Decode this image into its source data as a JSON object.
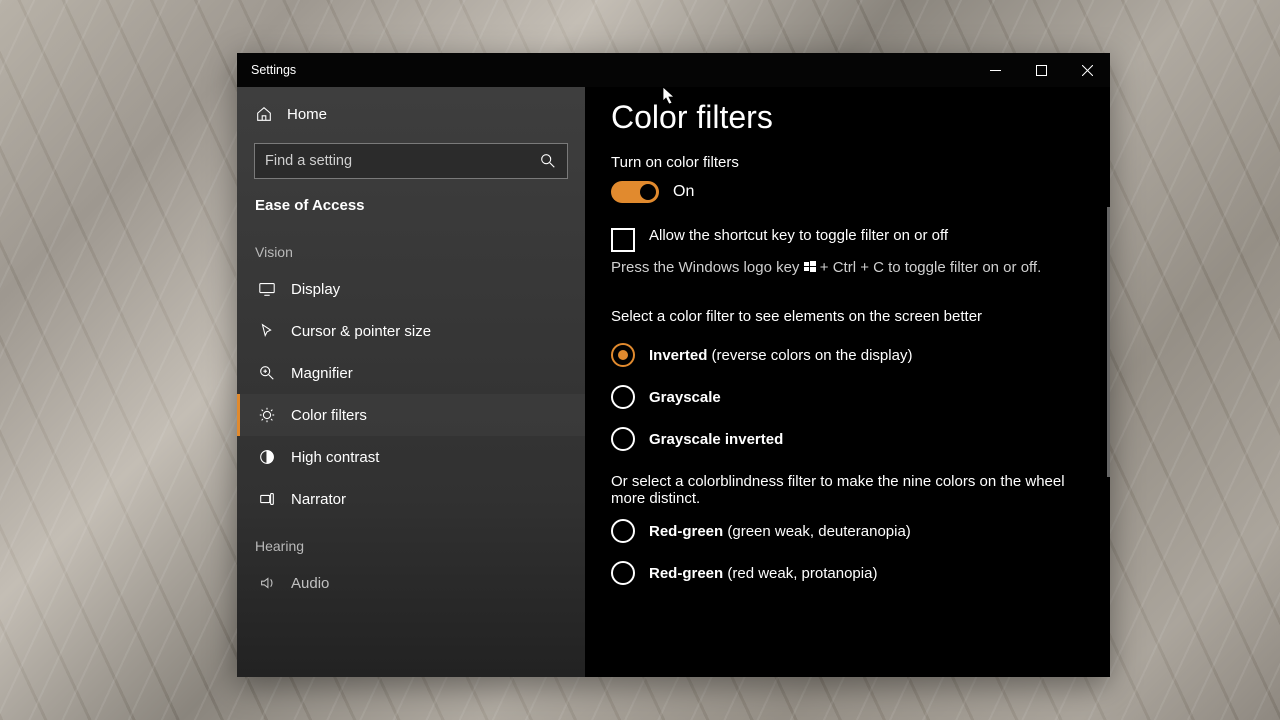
{
  "window": {
    "title": "Settings"
  },
  "sidebar": {
    "home": "Home",
    "search_placeholder": "Find a setting",
    "category": "Ease of Access",
    "groups": [
      {
        "label": "Vision",
        "items": [
          {
            "icon": "display-icon",
            "label": "Display"
          },
          {
            "icon": "cursor-icon",
            "label": "Cursor & pointer size"
          },
          {
            "icon": "magnifier-icon",
            "label": "Magnifier"
          },
          {
            "icon": "color-filters-icon",
            "label": "Color filters",
            "active": true
          },
          {
            "icon": "high-contrast-icon",
            "label": "High contrast"
          },
          {
            "icon": "narrator-icon",
            "label": "Narrator"
          }
        ]
      },
      {
        "label": "Hearing",
        "items": [
          {
            "icon": "audio-icon",
            "label": "Audio"
          }
        ]
      }
    ]
  },
  "content": {
    "title": "Color filters",
    "toggle_label": "Turn on color filters",
    "toggle_state_text": "On",
    "toggle_on": true,
    "shortcut_checkbox": {
      "checked": false,
      "label": "Allow the shortcut key to toggle filter on or off"
    },
    "shortcut_hint_prefix": "Press the Windows logo key ",
    "shortcut_hint_suffix": " + Ctrl + C to toggle filter on or off.",
    "filter_section": "Select a color filter to see elements on the screen better",
    "radios": [
      {
        "bold": "Inverted",
        "note": " (reverse colors on the display)",
        "selected": true
      },
      {
        "bold": "Grayscale",
        "note": "",
        "selected": false
      },
      {
        "bold": "Grayscale inverted",
        "note": "",
        "selected": false
      }
    ],
    "cb_section": "Or select a colorblindness filter to make the nine colors on the wheel more distinct.",
    "cb_radios": [
      {
        "bold": "Red-green",
        "note": " (green weak, deuteranopia)",
        "selected": false
      },
      {
        "bold": "Red-green",
        "note": " (red weak, protanopia)",
        "selected": false
      }
    ]
  },
  "colors": {
    "accent": "#e18a2e"
  }
}
